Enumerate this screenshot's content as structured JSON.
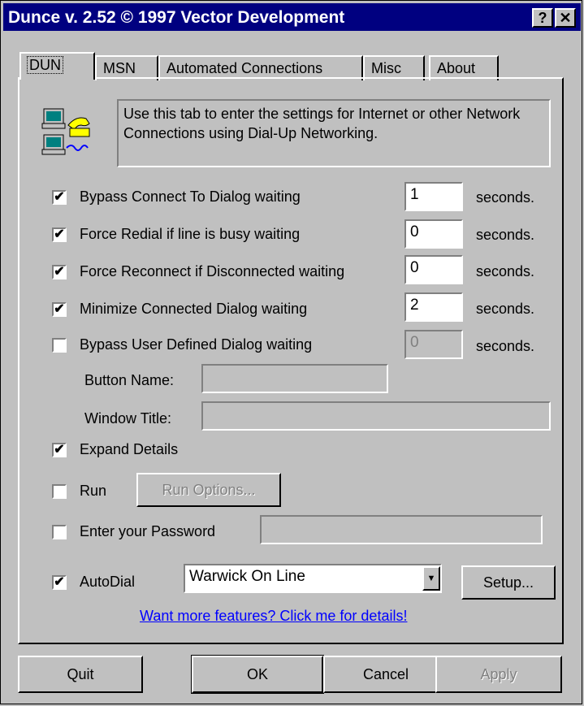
{
  "title": "Dunce v. 2.52 © 1997 Vector Development",
  "title_buttons": {
    "help": "?",
    "close": "✕"
  },
  "tabs": [
    "DUN",
    "MSN",
    "Automated Connections",
    "Misc",
    "About"
  ],
  "info_text": "Use this tab to enter the settings for Internet or other Network Connections using Dial-Up Networking.",
  "rows": [
    {
      "label": "Bypass Connect To Dialog waiting",
      "checked": true,
      "value": "1",
      "unit": "seconds."
    },
    {
      "label": "Force Redial if line is busy waiting",
      "checked": true,
      "value": "0",
      "unit": "seconds."
    },
    {
      "label": "Force Reconnect if Disconnected waiting",
      "checked": true,
      "value": "0",
      "unit": "seconds."
    },
    {
      "label": "Minimize Connected Dialog waiting",
      "checked": true,
      "value": "2",
      "unit": "seconds."
    },
    {
      "label": "Bypass User Defined Dialog waiting",
      "checked": false,
      "value": "0",
      "unit": "seconds."
    }
  ],
  "button_name_label": "Button Name:",
  "window_title_label": "Window Title:",
  "expand_details": {
    "label": "Expand Details",
    "checked": true
  },
  "run": {
    "label": "Run",
    "checked": false,
    "button": "Run Options..."
  },
  "password": {
    "label": "Enter your Password",
    "checked": false
  },
  "autodial": {
    "label": "AutoDial",
    "checked": true,
    "selected": "Warwick On Line",
    "setup": "Setup..."
  },
  "link_text": "Want more features? Click me for details!",
  "buttons": {
    "quit": "Quit",
    "ok": "OK",
    "cancel": "Cancel",
    "apply": "Apply"
  },
  "colors": {
    "titlebar": "#000080",
    "face": "#c0c0c0",
    "link": "#0000ff"
  }
}
